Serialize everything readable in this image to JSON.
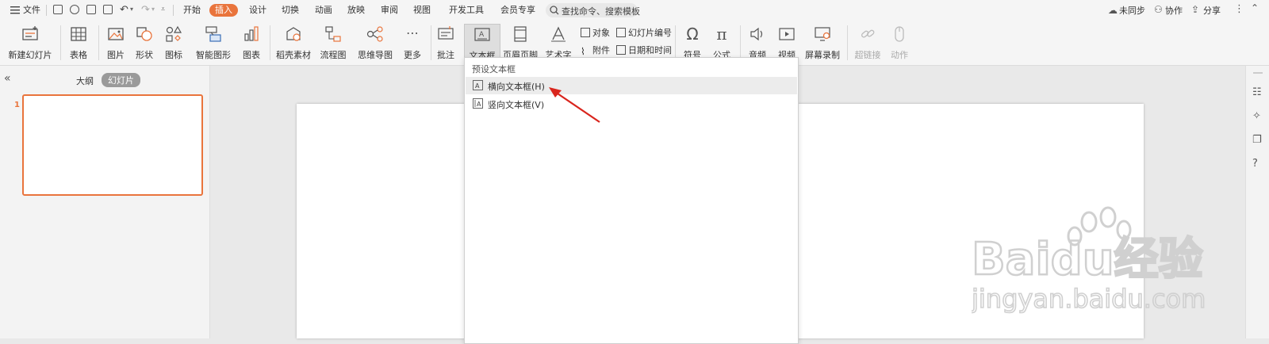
{
  "menubar": {
    "file_label": "文件",
    "tabs": [
      "开始",
      "插入",
      "设计",
      "切换",
      "动画",
      "放映",
      "审阅",
      "视图",
      "开发工具",
      "会员专享"
    ],
    "active_tab": "插入",
    "search_placeholder": "查找命令、搜索模板",
    "right": {
      "sync": "未同步",
      "collab": "协作",
      "share": "分享"
    }
  },
  "ribbon": {
    "buttons": [
      {
        "id": "new-slide",
        "label": "新建幻灯片"
      },
      {
        "id": "table",
        "label": "表格"
      },
      {
        "id": "picture",
        "label": "图片"
      },
      {
        "id": "shape",
        "label": "形状"
      },
      {
        "id": "icon",
        "label": "图标"
      },
      {
        "id": "smartart",
        "label": "智能图形"
      },
      {
        "id": "chart",
        "label": "图表"
      },
      {
        "id": "daoke",
        "label": "稻壳素材"
      },
      {
        "id": "flowchart",
        "label": "流程图"
      },
      {
        "id": "mindmap",
        "label": "思维导图"
      },
      {
        "id": "more",
        "label": "更多"
      },
      {
        "id": "comment",
        "label": "批注"
      },
      {
        "id": "textbox",
        "label": "文本框"
      },
      {
        "id": "header-footer",
        "label": "页眉页脚"
      },
      {
        "id": "wordart",
        "label": "艺术字"
      },
      {
        "id": "symbol",
        "label": "符号"
      },
      {
        "id": "formula",
        "label": "公式"
      },
      {
        "id": "audio",
        "label": "音频"
      },
      {
        "id": "video",
        "label": "视频"
      },
      {
        "id": "screen-record",
        "label": "屏幕录制"
      },
      {
        "id": "hyperlink",
        "label": "超链接"
      },
      {
        "id": "action",
        "label": "动作"
      }
    ],
    "small": {
      "object": "对象",
      "attachment": "附件",
      "slide_number": "幻灯片编号",
      "datetime": "日期和时间"
    }
  },
  "left_panel": {
    "outline_tab": "大纲",
    "slides_tab": "幻灯片",
    "slide_number": "1"
  },
  "dropdown": {
    "header": "预设文本框",
    "items": [
      {
        "label": "横向文本框(H)"
      },
      {
        "label": "竖向文本框(V)"
      }
    ]
  },
  "watermark": {
    "brand": "Baidu经验",
    "url": "jingyan.baidu.com"
  },
  "colors": {
    "accent": "#e9743c",
    "arrow": "#d9251d"
  }
}
